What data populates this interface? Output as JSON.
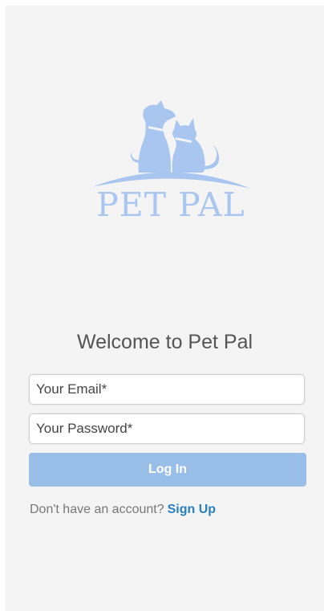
{
  "brand": {
    "name": "PET PAL"
  },
  "welcome": {
    "title": "Welcome to Pet Pal"
  },
  "form": {
    "email_placeholder": "Your Email*",
    "password_placeholder": "Your Password*",
    "login_label": "Log In"
  },
  "signup": {
    "prompt": "Don't have an account?",
    "link_label": "Sign Up"
  },
  "colors": {
    "background": "#f4f4f4",
    "logo": "#a8c6ef",
    "button": "#99bfe8",
    "link": "#2a7fc0"
  }
}
